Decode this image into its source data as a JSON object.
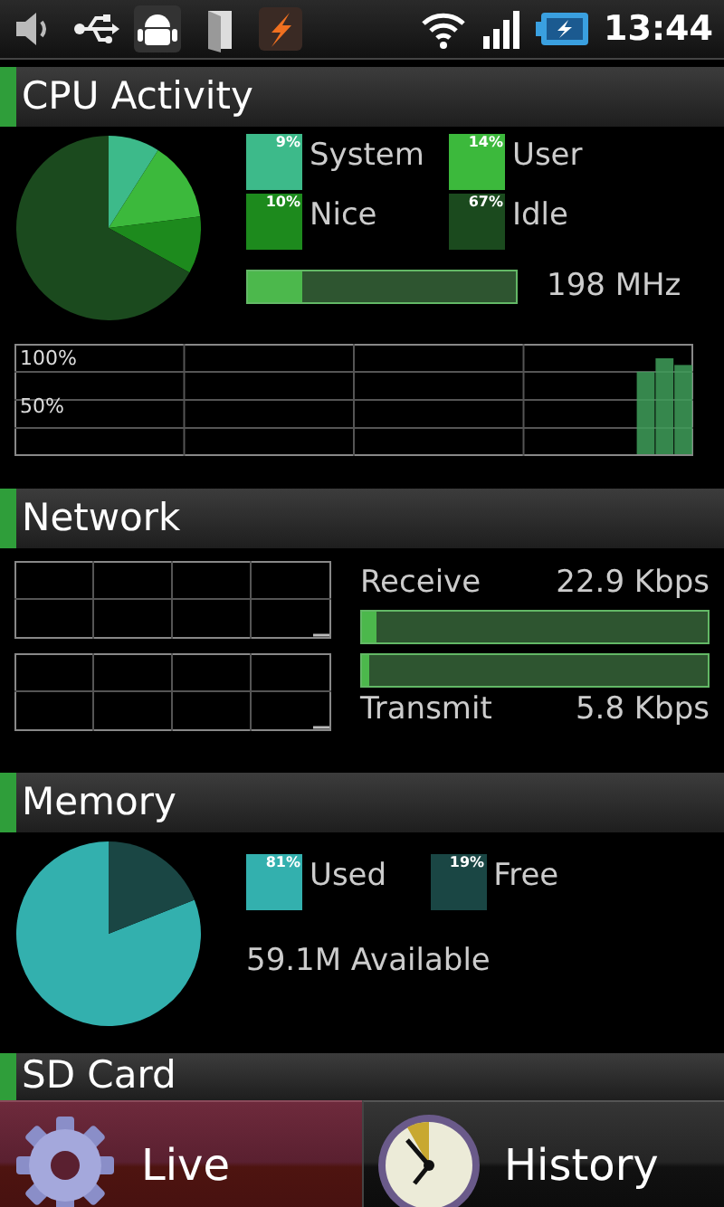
{
  "status_bar": {
    "time": "13:44"
  },
  "cpu": {
    "title": "CPU Activity",
    "legend": [
      {
        "percent": "9%",
        "color": "#3dba8a"
      },
      {
        "percent": "14%",
        "color": "#3cb93c"
      },
      {
        "percent": "10%",
        "color": "#1d8a1d"
      },
      {
        "percent": "67%",
        "color": "#1b4a1e"
      }
    ],
    "chart_data": {
      "type": "pie",
      "categories": [
        "System",
        "User",
        "Nice",
        "Idle"
      ],
      "values": [
        9,
        14,
        10,
        67
      ]
    },
    "frequency": {
      "level": 0.2,
      "reading": "198 MHz"
    },
    "history": {
      "chart_data": {
        "type": "bar",
        "ylim": [
          0,
          100
        ],
        "yticks": [
          {
            "value": 100,
            "label": "100%"
          },
          {
            "value": 50,
            "label": "50%"
          }
        ],
        "values": [
          null,
          null,
          null,
          null,
          null,
          null,
          null,
          null,
          null,
          null,
          null,
          null,
          null,
          null,
          null,
          null,
          null,
          null,
          null,
          null,
          null,
          null,
          null,
          null,
          null,
          null,
          null,
          null,
          null,
          null,
          null,
          null,
          null,
          86,
          100,
          93
        ]
      }
    }
  },
  "network": {
    "title": "Network",
    "receive": {
      "label": "Receive",
      "reading": "22.9 Kbps",
      "level": 0.04
    },
    "transmit": {
      "label": "Transmit",
      "reading": "5.8 Kbps",
      "level": 0.02
    }
  },
  "memory": {
    "title": "Memory",
    "legend": [
      {
        "percent": "81%",
        "color": "#33b0ae"
      },
      {
        "percent": "19%",
        "color": "#1a4644"
      }
    ],
    "chart_data": {
      "type": "pie",
      "categories": [
        "Used",
        "Free"
      ],
      "values": [
        81,
        19
      ]
    },
    "available": "59.1M Available"
  },
  "sd_card": {
    "title": "SD Card"
  },
  "tabs": [
    {
      "label": "Live",
      "selected": true,
      "kind": "gear"
    },
    {
      "label": "History",
      "selected": false,
      "kind": "clock"
    }
  ]
}
